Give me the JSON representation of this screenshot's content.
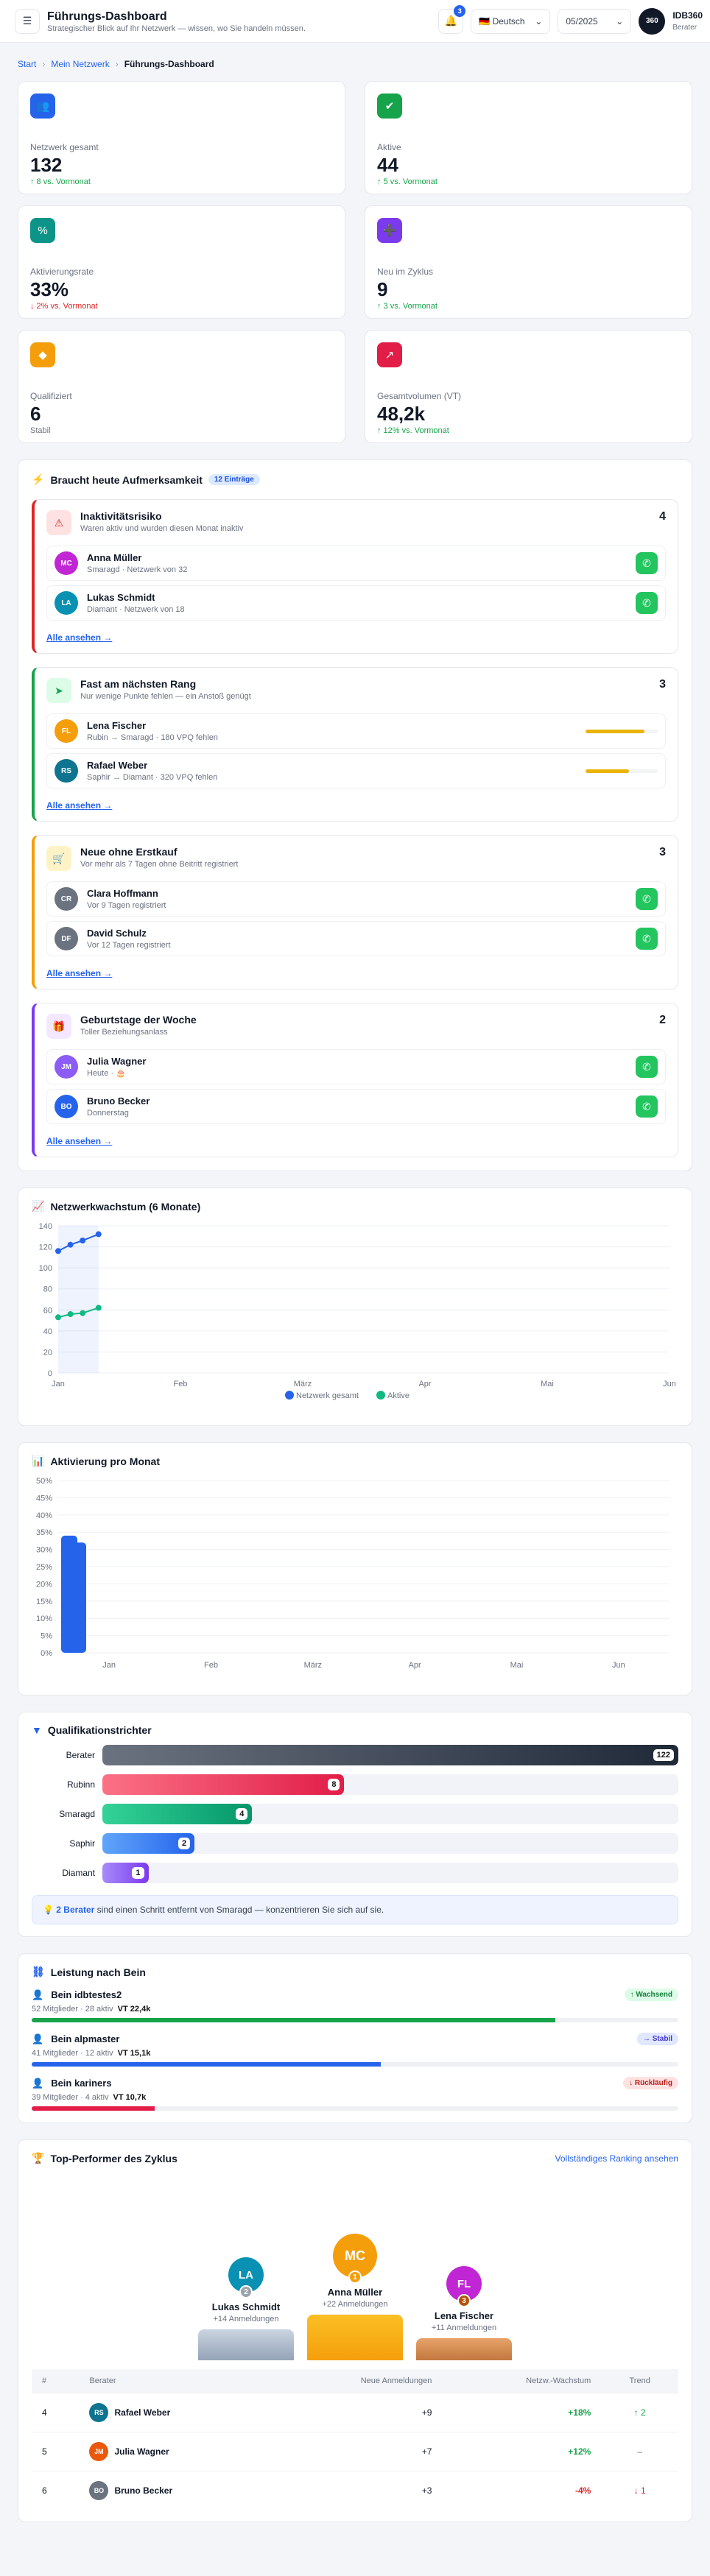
{
  "topbar": {
    "title": "Führungs-Dashboard",
    "subtitle": "Strategischer Blick auf Ihr Netzwerk — wissen, wo Sie handeln müssen.",
    "notif_count": "3",
    "lang": "🇩🇪 Deutsch",
    "period": "05/2025",
    "avatar": "360",
    "user_name": "IDB360",
    "user_role": "Berater"
  },
  "breadcrumb": {
    "home": "Start",
    "network": "Mein Netzwerk",
    "current": "Führungs-Dashboard"
  },
  "kpis": [
    {
      "label": "Netzwerk gesamt",
      "value": "132",
      "trend": "↑ 8 vs. Vormonat",
      "dir": "up",
      "icon": "users-icon",
      "color": "#2563eb"
    },
    {
      "label": "Aktive",
      "value": "44",
      "trend": "↑ 5 vs. Vormonat",
      "dir": "up",
      "icon": "check-circle-icon",
      "color": "#16a34a"
    },
    {
      "label": "Aktivierungsrate",
      "value": "33%",
      "trend": "↓ 2% vs. Vormonat",
      "dir": "down",
      "icon": "percent-icon",
      "color": "#0d9488"
    },
    {
      "label": "Neu im Zyklus",
      "value": "9",
      "trend": "↑ 3 vs. Vormonat",
      "dir": "up",
      "icon": "user-plus-icon",
      "color": "#7c3aed"
    },
    {
      "label": "Qualifiziert",
      "value": "6",
      "trend": "Stabil",
      "dir": "flat",
      "icon": "diamond-icon",
      "color": "#f59e0b"
    },
    {
      "label": "Gesamtvolumen (VT)",
      "value": "48,2k",
      "trend": "↑ 12% vs. Vormonat",
      "dir": "up",
      "icon": "trending-up-icon",
      "color": "#e11d48"
    }
  ],
  "attention": {
    "title": "Braucht heute Aufmerksamkeit",
    "count_pill": "12 Einträge",
    "view_all": "Alle ansehen →",
    "groups": [
      {
        "title": "Inaktivitätsrisiko",
        "subtitle": "Waren aktiv und wurden diesen Monat inaktiv",
        "count": "4",
        "color": "#dc2626",
        "icon_bg": "#fee2e2",
        "icon": "⚠",
        "icon_name": "warning-icon",
        "action": "whatsapp",
        "people": [
          {
            "initials": "MC",
            "name": "Anna Müller",
            "meta": "Smaragd · Netzwerk von 32",
            "color": "#c026d3"
          },
          {
            "initials": "LA",
            "name": "Lukas Schmidt",
            "meta": "Diamant · Netzwerk von 18",
            "color": "#0891b2"
          }
        ]
      },
      {
        "title": "Fast am nächsten Rang",
        "subtitle": "Nur wenige Punkte fehlen — ein Anstoß genügt",
        "count": "3",
        "color": "#16a34a",
        "icon_bg": "#dcfce7",
        "icon": "➤",
        "icon_name": "rocket-icon",
        "action": "progress",
        "people": [
          {
            "initials": "FL",
            "name": "Lena Fischer",
            "meta": "Rubin → Smaragd · 180 VPQ fehlen",
            "color": "#f59e0b",
            "progress": 0.82
          },
          {
            "initials": "RS",
            "name": "Rafael Weber",
            "meta": "Saphir → Diamant · 320 VPQ fehlen",
            "color": "#0e7490",
            "progress": 0.6
          }
        ]
      },
      {
        "title": "Neue ohne Erstkauf",
        "subtitle": "Vor mehr als 7 Tagen ohne Beitritt registriert",
        "count": "3",
        "color": "#f59e0b",
        "icon_bg": "#fef3c7",
        "icon": "🛒",
        "icon_name": "cart-icon",
        "action": "whatsapp",
        "people": [
          {
            "initials": "CR",
            "name": "Clara Hoffmann",
            "meta": "Vor 9 Tagen registriert",
            "color": "#6b7280"
          },
          {
            "initials": "DF",
            "name": "David Schulz",
            "meta": "Vor 12 Tagen registriert",
            "color": "#6b7280"
          }
        ]
      },
      {
        "title": "Geburtstage der Woche",
        "subtitle": "Toller Beziehungsanlass",
        "count": "2",
        "color": "#7c3aed",
        "icon_bg": "#f3e8ff",
        "icon": "🎁",
        "icon_name": "gift-icon",
        "action": "whatsapp",
        "people": [
          {
            "initials": "JM",
            "name": "Julia Wagner",
            "meta": "Heute · 🎂",
            "color": "#8b5cf6"
          },
          {
            "initials": "BO",
            "name": "Bruno Becker",
            "meta": "Donnerstag",
            "color": "#2563eb"
          }
        ]
      }
    ]
  },
  "chart_data": [
    {
      "type": "line",
      "title": "Netzwerkwachstum (6 Monate)",
      "x": [
        "Jan",
        "Feb",
        "März",
        "Apr",
        "Mai",
        "Jun"
      ],
      "ylim": [
        0,
        140
      ],
      "yticks": [
        0,
        20,
        40,
        60,
        80,
        100,
        120,
        140
      ],
      "series": [
        {
          "name": "Netzwerk gesamt",
          "color": "#2563eb",
          "values": [
            116,
            122,
            126,
            132
          ]
        },
        {
          "name": "Aktive",
          "color": "#10b981",
          "values": [
            53,
            56,
            57,
            62
          ]
        }
      ],
      "point_x": [
        0,
        0.1,
        0.2,
        0.33
      ]
    },
    {
      "type": "bar",
      "title": "Aktivierung pro Monat",
      "categories": [
        "Jan",
        "Feb",
        "März",
        "Apr",
        "Mai",
        "Jun"
      ],
      "ylim": [
        0,
        50
      ],
      "yticks": [
        "0%",
        "5%",
        "10%",
        "15%",
        "20%",
        "25%",
        "30%",
        "35%",
        "40%",
        "45%",
        "50%"
      ],
      "series": [
        {
          "name": "Aktivierung",
          "color": "#2563eb",
          "values": [
            34,
            32
          ]
        }
      ]
    }
  ],
  "funnel": {
    "title": "Qualifikationstrichter",
    "rows": [
      {
        "label": "Berater",
        "value": 122,
        "frac": 1,
        "grad": "linear-gradient(90deg,#6b7280,#1f2937)"
      },
      {
        "label": "Rubinn",
        "value": 8,
        "frac": 0.42,
        "grad": "linear-gradient(90deg,#fb7185,#e11d48)"
      },
      {
        "label": "Smaragd",
        "value": 4,
        "frac": 0.26,
        "grad": "linear-gradient(90deg,#34d399,#059669)"
      },
      {
        "label": "Saphir",
        "value": 2,
        "frac": 0.16,
        "grad": "linear-gradient(90deg,#60a5fa,#2563eb)"
      },
      {
        "label": "Diamant",
        "value": 1,
        "frac": 0.08,
        "grad": "linear-gradient(90deg,#a78bfa,#7c3aed)"
      }
    ],
    "hint_strong": "2 Berater",
    "hint_text": " sind einen Schritt entfernt von Smaragd — konzentrieren Sie sich auf sie."
  },
  "legs": {
    "title": "Leistung nach Bein",
    "items": [
      {
        "name": "Bein idbtestes2",
        "meta": "52 Mitglieder · 28 aktiv",
        "vt": "VT 22,4k",
        "badge": "↑ Wachsend",
        "badge_bg": "#dcfce7",
        "badge_fg": "#15803d",
        "bar": 0.81,
        "bar_color": "#16a34a"
      },
      {
        "name": "Bein alpmaster",
        "meta": "41 Mitglieder · 12 aktiv",
        "vt": "VT 15,1k",
        "badge": "→ Stabil",
        "badge_bg": "#e0e7ff",
        "badge_fg": "#4338ca",
        "bar": 0.54,
        "bar_color": "#2563eb"
      },
      {
        "name": "Bein kariners",
        "meta": "39 Mitglieder · 4 aktiv",
        "vt": "VT 10,7k",
        "badge": "↓ Rückläufig",
        "badge_bg": "#fee2e2",
        "badge_fg": "#b91c1c",
        "bar": 0.19,
        "bar_color": "#e11d48"
      }
    ]
  },
  "top": {
    "title": "Top-Performer des Zyklus",
    "link": "Vollständiges Ranking ansehen",
    "podium": [
      {
        "initials": "LA",
        "name": "Lukas Schmidt",
        "sub": "+14 Anmeldungen",
        "rank": "2",
        "color": "#0891b2",
        "rank_color": "#9ca3af",
        "block": "linear-gradient(#cbd5e1,#94a3b8)",
        "h": 42
      },
      {
        "initials": "MC",
        "name": "Anna Müller",
        "sub": "+22 Anmeldungen",
        "rank": "1",
        "color": "#f59e0b",
        "rank_color": "#f59e0b",
        "block": "linear-gradient(#fbbf24,#f59e0b)",
        "h": 62
      },
      {
        "initials": "FL",
        "name": "Lena Fischer",
        "sub": "+11 Anmeldungen",
        "rank": "3",
        "color": "#c026d3",
        "rank_color": "#b45309",
        "block": "linear-gradient(#e8a36a,#c2773d)",
        "h": 30
      }
    ],
    "headers": [
      "#",
      "Berater",
      "Neue Anmeldungen",
      "Netzw.-Wachstum",
      "Trend"
    ],
    "rows": [
      {
        "rank": "4",
        "initials": "RS",
        "name": "Rafael Weber",
        "color": "#0e7490",
        "new": "+9",
        "growth": "+18%",
        "gcolor": "#16a34a",
        "trend": "↑ 2",
        "tcolor": "#16a34a"
      },
      {
        "rank": "5",
        "initials": "JM",
        "name": "Julia Wagner",
        "color": "#ea580c",
        "new": "+7",
        "growth": "+12%",
        "gcolor": "#16a34a",
        "trend": "–",
        "tcolor": "#6b7280"
      },
      {
        "rank": "6",
        "initials": "BO",
        "name": "Bruno Becker",
        "color": "#6b7280",
        "new": "+3",
        "growth": "-4%",
        "gcolor": "#dc2626",
        "trend": "↓ 1",
        "tcolor": "#dc2626"
      }
    ]
  }
}
